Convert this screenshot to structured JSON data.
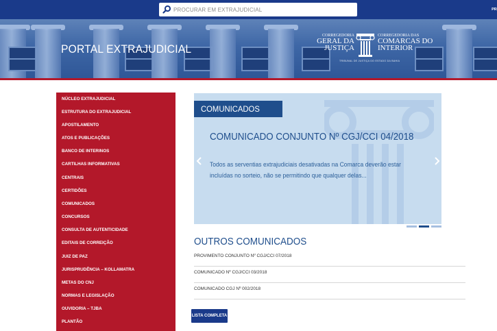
{
  "search": {
    "placeholder": "PROCURAR EM EXTRAJUDICIAL",
    "button_label": "PROCURAR"
  },
  "header": {
    "portal_title": "PORTAL EXTRAJUDICIAL",
    "logo": {
      "left_small": "CORREGEDORIA",
      "left_large_1": "GERAL DA",
      "left_large_2": "JUSTIÇA",
      "right_small": "CORREGEDORIA DAS",
      "right_large_1": "COMARCAS DO",
      "right_large_2": "INTERIOR",
      "subtitle": "TRIBUNAL DE JUSTIÇA DO ESTADO DA BAHIA"
    }
  },
  "sidebar": {
    "items": [
      {
        "label": "NÚCLEO EXTRAJUDICIAL"
      },
      {
        "label": "ESTRUTURA DO EXTRAJUDICIAL"
      },
      {
        "label": "APOSTILAMENTO"
      },
      {
        "label": "ATOS E PUBLICAÇÕES"
      },
      {
        "label": "BANCO DE INTERINOS"
      },
      {
        "label": "CARTILHAS INFORMATIVAS"
      },
      {
        "label": "CENTRAIS"
      },
      {
        "label": "CERTIDÕES"
      },
      {
        "label": "COMUNICADOS"
      },
      {
        "label": "CONCURSOS"
      },
      {
        "label": "CONSULTA DE AUTENTICIDADE"
      },
      {
        "label": "EDITAIS DE CORREIÇÃO"
      },
      {
        "label": "JUIZ DE PAZ"
      },
      {
        "label": "JURISPRUDÊNCIA – KOLLAMATRA"
      },
      {
        "label": "METAS DO CNJ"
      },
      {
        "label": "NORMAS E LEGISLAÇÃO"
      },
      {
        "label": "OUVIDORIA – TJBA"
      },
      {
        "label": "PLANTÃO"
      }
    ]
  },
  "carousel": {
    "label": "COMUNICADOS",
    "title": "COMUNICADO CONJUNTO Nº CGJ/CCI 04/2018",
    "text": "Todos as serventias extrajudiciais desativadas na Comarca deverão estar incluídas no sorteio, não se permitindo que qualquer delas...",
    "active_slide": 2,
    "slide_count": 3
  },
  "outros": {
    "title": "OUTROS COMUNICADOS",
    "items": [
      {
        "label": "PROVIMENTO CONJUNTO Nº CGJ/CCI 07/2018"
      },
      {
        "label": "COMUNICADO Nº CGJ/CCI 03/2018"
      },
      {
        "label": "COMUNICADO CGJ Nº 002/2018"
      }
    ],
    "list_button": "LISTA COMPLETA"
  },
  "colors": {
    "navy": "#1a3a8a",
    "sidebar_red": "#b3182a",
    "accent_blue": "#1f4e8c",
    "carousel_bg": "#c7dcef"
  }
}
